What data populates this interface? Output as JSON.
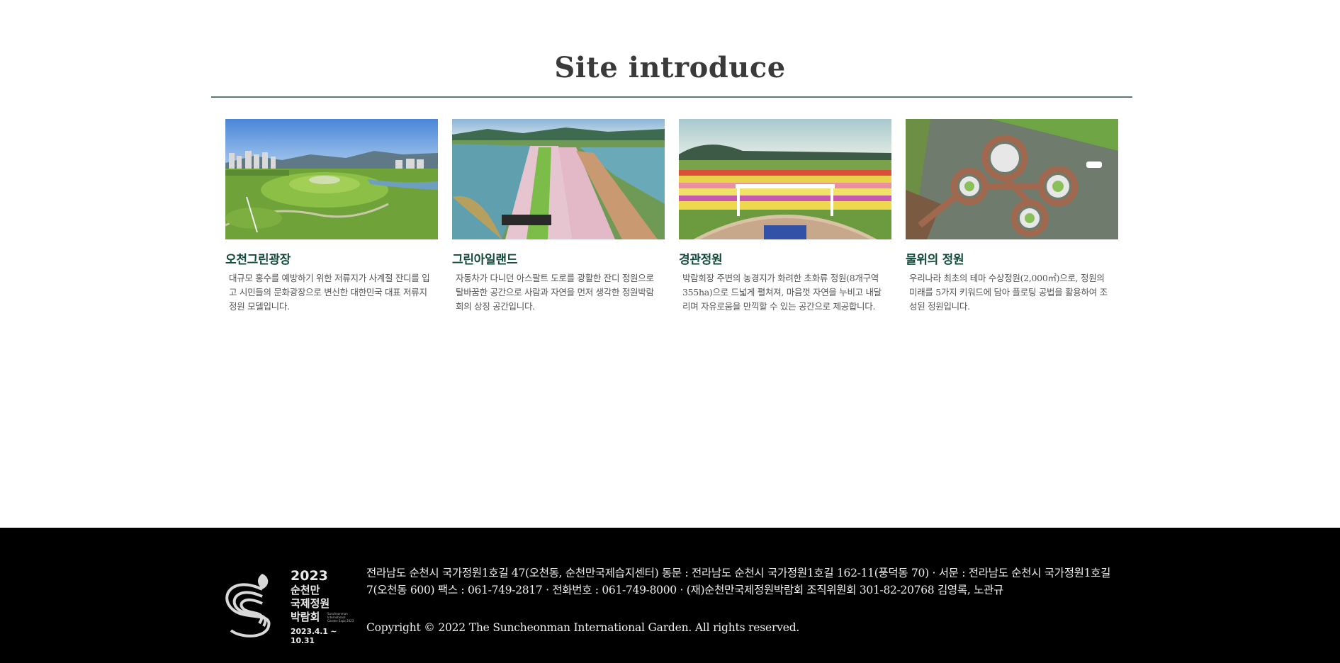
{
  "section": {
    "title": "Site introduce"
  },
  "cards": [
    {
      "title": "오천그린광장",
      "description": "대규모 홍수를 예방하기 위한 저류지가 사계절 잔디를 입고 시민들의 문화광장으로 변신한 대한민국 대표 저류지 정원 모델입니다."
    },
    {
      "title": "그린아일랜드",
      "description": "자동차가 다니던 아스팔트 도로를 광활한 잔디 정원으로 탈바꿈한 공간으로 사람과 자연을 먼저 생각한 정원박람회의 상징 공간입니다."
    },
    {
      "title": "경관정원",
      "description": "박람회장 주변의 농경지가 화려한 초화류 정원(8개구역 355ha)으로 드넓게 펼쳐져, 마음껏 자연을 누비고 내달리며 자유로움을 만끽할 수 있는 공간으로 제공합니다."
    },
    {
      "title": "물위의 정원",
      "description": "우리나라 최초의 테마 수상정원(2,000㎡)으로, 정원의 미래를 5가지 키워드에 담아 플로팅 공법을 활용하여 조성된 정원입니다."
    }
  ],
  "footer": {
    "logo": {
      "year": "2023",
      "line1": "순천만",
      "line2": "국제정원",
      "line3": "박람회",
      "english": "Suncheonman International Garden Expo 2023",
      "dates": "2023.4.1 ~ 10.31"
    },
    "address": "전라남도 순천시 국가정원1호길 47(오천동, 순천만국제습지센터) 동문 : 전라남도 순천시 국가정원1호길 162-11(풍덕동 70) · 서문 : 전라남도 순천시 국가정원1호길 7(오천동 600) 팩스 : 061-749-2817 · 전화번호 : 061-749-8000 · (재)순천만국제정원박람회 조직위원회 301-82-20768 김영록, 노관규",
    "copyright": "Copyright © 2022 The Suncheonman International Garden. All rights reserved."
  }
}
